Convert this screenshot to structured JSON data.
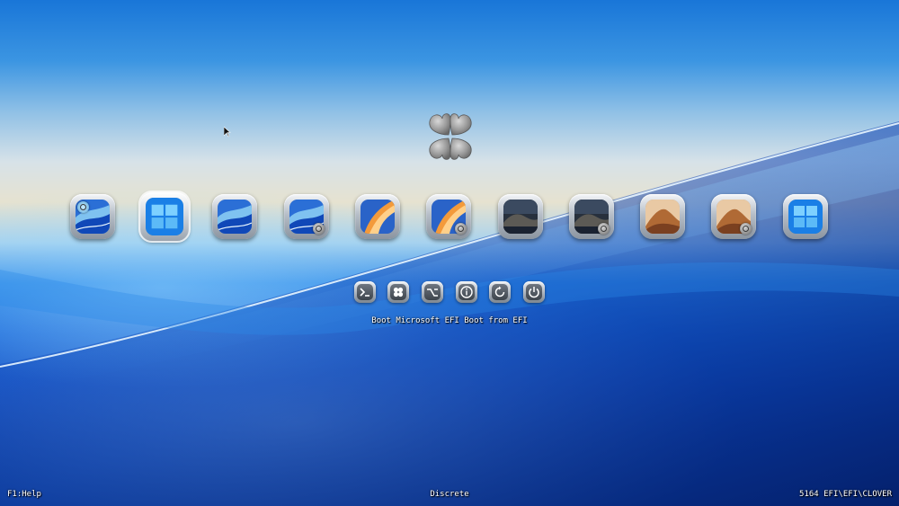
{
  "entries": [
    {
      "name": "boot-macos-sonoma-recovery",
      "artwork": "sonoma-wave",
      "badge": "install-icon",
      "selected": false
    },
    {
      "name": "boot-microsoft-efi",
      "artwork": "windows-logo",
      "badge": "none",
      "selected": true
    },
    {
      "name": "boot-macos-sonoma",
      "artwork": "sonoma-wave",
      "badge": "none",
      "selected": false
    },
    {
      "name": "boot-macos-sonoma-data",
      "artwork": "sonoma-wave",
      "badge": "disk-icon",
      "selected": false
    },
    {
      "name": "boot-macos-ventura",
      "artwork": "ventura-light",
      "badge": "none",
      "selected": false
    },
    {
      "name": "boot-macos-ventura-data",
      "artwork": "ventura-light",
      "badge": "disk-icon",
      "selected": false
    },
    {
      "name": "boot-macos-catalina",
      "artwork": "catalina-island",
      "badge": "none",
      "selected": false
    },
    {
      "name": "boot-macos-catalina-data",
      "artwork": "catalina-island",
      "badge": "disk-icon",
      "selected": false
    },
    {
      "name": "boot-macos-mojave",
      "artwork": "mojave-dune",
      "badge": "none",
      "selected": false
    },
    {
      "name": "boot-macos-mojave-data",
      "artwork": "mojave-dune",
      "badge": "disk-icon",
      "selected": false
    },
    {
      "name": "boot-windows",
      "artwork": "windows-logo",
      "badge": "none",
      "selected": false
    }
  ],
  "tools": [
    {
      "name": "shell-tool",
      "icon": "terminal-icon"
    },
    {
      "name": "clover-options-tool",
      "icon": "clover-icon"
    },
    {
      "name": "options-tool",
      "icon": "option-key-icon"
    },
    {
      "name": "about-tool",
      "icon": "info-icon"
    },
    {
      "name": "reset-tool",
      "icon": "restart-icon"
    },
    {
      "name": "shutdown-tool",
      "icon": "power-icon"
    }
  ],
  "message": "Boot Microsoft EFI Boot from EFI",
  "footer": {
    "help": "F1:Help",
    "mode": "Discrete",
    "revision": "5164 EFI\\EFI\\CLOVER"
  },
  "colors": {
    "accent_blue": "#1a6fe0",
    "text": "#ffffff"
  }
}
